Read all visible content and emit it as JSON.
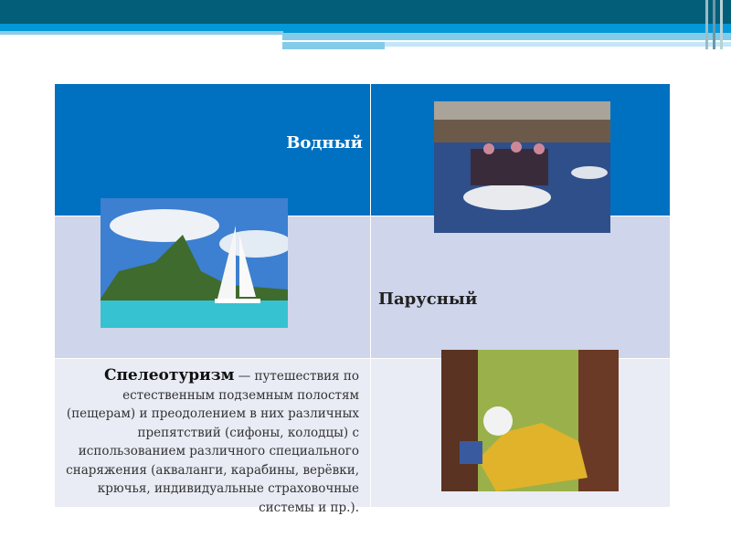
{
  "table": {
    "header_label": "Водный",
    "row2_label": "Парусный",
    "speleo": {
      "term": "Спелеотуризм",
      "lines": [
        "— путешествия по",
        "естественным подземным полостям",
        "(пещерам) и преодолением в них различных",
        "препятствий (сифоны, колодцы) с",
        "использованием различного специального",
        "снаряжения (акваланги, карабины, верёвки,",
        "крючья, индивидуальные страховочные",
        "системы и пр.)."
      ]
    }
  },
  "colors": {
    "header": "#0070c0",
    "row2": "#cfd5ea",
    "row3": "#e9ebf5",
    "banner": "#035e79"
  }
}
